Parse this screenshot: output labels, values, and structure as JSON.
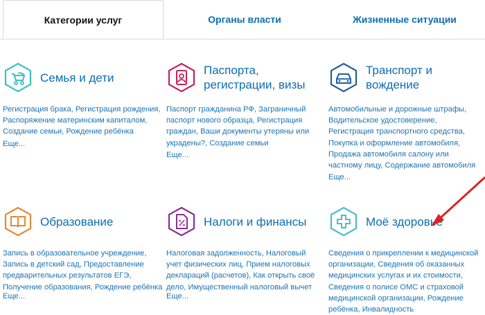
{
  "tabs": [
    {
      "label": "Категории услуг",
      "active": true
    },
    {
      "label": "Органы власти",
      "active": false
    },
    {
      "label": "Жизненные ситуации",
      "active": false
    }
  ],
  "categories": [
    {
      "title": "Семья и дети",
      "icon": "stroller-icon",
      "color": "#3bbfc9",
      "desc": "Регистрация брака, Регистрация рождения, Распоряжение материнским капиталом, Создание семьи, Рождение ребёнка",
      "more": "Еще..."
    },
    {
      "title": "Паспорта, регистрации, визы",
      "icon": "id-badge-icon",
      "color": "#c4225a",
      "desc": "Паспорт гражданина РФ, Заграничный паспорт нового образца, Регистрация граждан, Ваши документы утеряны или украдены?, Создание семьи",
      "more": "Еще..."
    },
    {
      "title": "Транспорт и вождение",
      "icon": "car-icon",
      "color": "#1f5f9a",
      "desc": "Автомобильные и дорожные штрафы, Водительское удостоверение, Регистрация транспортного средства, Покупка и оформление автомобиля, Продажа автомобиля салону или частному лицу, Содержание автомобиля",
      "more": "Еще..."
    },
    {
      "title": "Образование",
      "icon": "book-icon",
      "color": "#e38a35",
      "desc": "Запись в образовательное учреждение, Запись в детский сад, Предоставление предварительных результатов ЕГЭ, Получение образования, Рождение ребёнка",
      "more": "Еще..."
    },
    {
      "title": "Налоги и финансы",
      "icon": "tax-document-icon",
      "color": "#8a2f8f",
      "desc": "Налоговая задолженность, Налоговый учет физических лиц, Прием налоговых деклараций (расчетов), Как открыть своё дело, Имущественный налоговый вычет",
      "more": "Еще..."
    },
    {
      "title": "Моё здоровье",
      "icon": "medical-cross-icon",
      "color": "#4dbcc4",
      "desc": "Сведения о прикреплении к медицинской организации, Сведения об оказанных медицинских услугах и их стоимости, Сведения о полисе ОМС и страховой медицинской организации, Рождение ребёнка, Инвалидность",
      "more": ""
    }
  ],
  "annotation": {
    "color": "#e02020",
    "icon": "red-arrow-icon"
  }
}
